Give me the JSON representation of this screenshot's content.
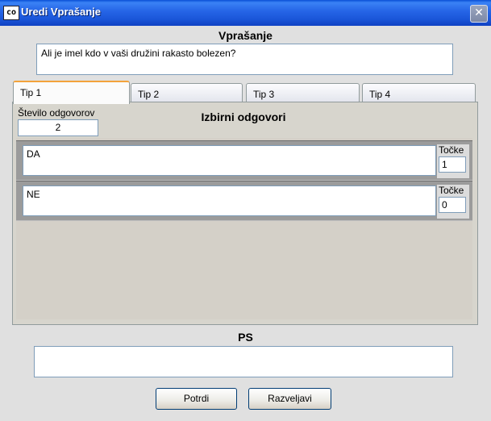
{
  "window": {
    "title": "Uredi Vprašanje",
    "icon_text": "co"
  },
  "question": {
    "heading": "Vprašanje",
    "text": "Ali je imel kdo v vaši družini rakasto bolezen?"
  },
  "tabs": [
    {
      "label": "Tip 1",
      "active": true
    },
    {
      "label": "Tip 2",
      "active": false
    },
    {
      "label": "Tip 3",
      "active": false
    },
    {
      "label": "Tip 4",
      "active": false
    }
  ],
  "answers_count": {
    "label": "Število odgovorov",
    "value": "2"
  },
  "answers": {
    "heading": "Izbirni odgovori",
    "points_label": "Točke",
    "items": [
      {
        "text": "DA",
        "points": "1"
      },
      {
        "text": "NE",
        "points": "0"
      }
    ]
  },
  "ps": {
    "heading": "PS",
    "text": ""
  },
  "buttons": {
    "confirm": "Potrdi",
    "cancel": "Razveljavi"
  },
  "colors": {
    "titlebar": "#2767e8",
    "tab_active_accent": "#f3a33b",
    "input_border": "#7f9db9"
  }
}
